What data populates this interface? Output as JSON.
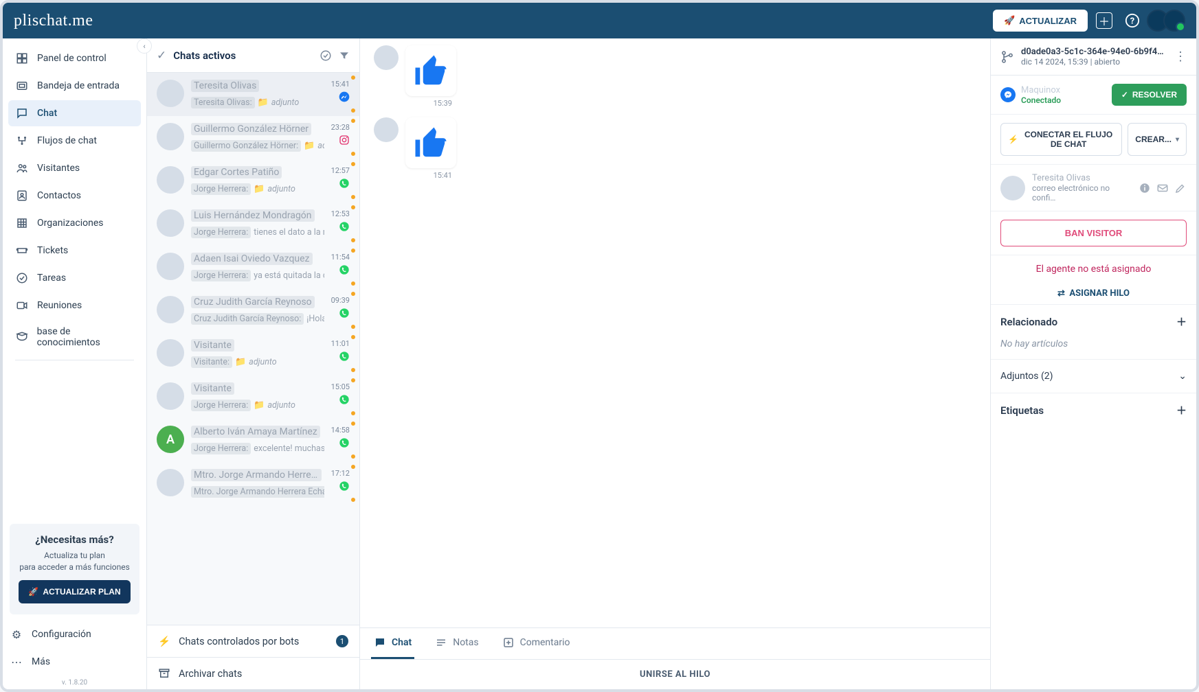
{
  "brand": {
    "name": "plischat.me",
    "tagline": ""
  },
  "topbar": {
    "update_label": "ACTUALIZAR"
  },
  "sidebar": {
    "items": [
      {
        "label": "Panel de control",
        "icon": "dashboard"
      },
      {
        "label": "Bandeja de entrada",
        "icon": "inbox"
      },
      {
        "label": "Chat",
        "icon": "chat",
        "active": true
      },
      {
        "label": "Flujos de chat",
        "icon": "flow"
      },
      {
        "label": "Visitantes",
        "icon": "visitors"
      },
      {
        "label": "Contactos",
        "icon": "contacts"
      },
      {
        "label": "Organizaciones",
        "icon": "org"
      },
      {
        "label": "Tickets",
        "icon": "tickets"
      },
      {
        "label": "Tareas",
        "icon": "tasks"
      },
      {
        "label": "Reuniones",
        "icon": "meetings"
      },
      {
        "label": "base de conocimientos",
        "icon": "kb"
      }
    ],
    "settings_label": "Configuración",
    "more_label": "Más",
    "version": "v. 1.8.20",
    "upgrade": {
      "title": "¿Necesitas más?",
      "line1": "Actualiza tu plan",
      "line2": "para acceder a más funciones",
      "button": "ACTUALIZAR PLAN"
    }
  },
  "chats": {
    "header_title": "Chats activos",
    "bot_section": "Chats controlados por bots",
    "bot_badge": "1",
    "archive_section": "Archivar chats",
    "items": [
      {
        "name": "Teresita Olivas",
        "author": "Teresita Olivas:",
        "preview": "adjunto",
        "is_attachment": true,
        "time": "15:41",
        "channel": "messenger",
        "active": true
      },
      {
        "name": "Guillermo González Hörner",
        "author": "Guillermo González Hörner:",
        "preview": "adju…",
        "is_attachment": true,
        "time": "23:28",
        "channel": "instagram"
      },
      {
        "name": "Edgar Cortes Patiño",
        "author": "Jorge Herrera:",
        "preview": "adjunto",
        "is_attachment": true,
        "time": "12:57",
        "channel": "whatsapp"
      },
      {
        "name": "Luis Hernández Mondragón",
        "author": "Jorge Herrera:",
        "preview": "tienes el dato a la m…",
        "is_attachment": false,
        "time": "12:53",
        "channel": "whatsapp"
      },
      {
        "name": "Adaen Isai Oviedo Vazquez",
        "author": "Jorge Herrera:",
        "preview": "ya está quitada la de …",
        "is_attachment": false,
        "time": "11:54",
        "channel": "whatsapp"
      },
      {
        "name": "Cruz Judith García Reynoso",
        "author": "Cruz Judith García Reynoso:",
        "preview": "¡Hola, …",
        "is_attachment": false,
        "time": "09:39",
        "channel": "whatsapp"
      },
      {
        "name": "Visitante",
        "author": "Visitante:",
        "preview": "adjunto",
        "is_attachment": true,
        "time": "11:01",
        "channel": "whatsapp"
      },
      {
        "name": "Visitante",
        "author": "Jorge Herrera:",
        "preview": "adjunto",
        "is_attachment": true,
        "time": "15:05",
        "channel": "whatsapp"
      },
      {
        "name": "Alberto Iván Amaya Martínez",
        "author": "Jorge Herrera:",
        "preview": "excelente! muchas g…",
        "is_attachment": false,
        "time": "14:58",
        "channel": "whatsapp",
        "avatar_letter": "A",
        "avatar_color": "#4caf50"
      },
      {
        "name": "Mtro. Jorge Armando Herrera E…",
        "author": "Mtro. Jorge Armando Herrera Echau…",
        "preview": "",
        "is_attachment": false,
        "time": "17:12",
        "channel": "whatsapp"
      }
    ]
  },
  "conversation": {
    "messages": [
      {
        "time": "15:39"
      },
      {
        "time": "15:41"
      }
    ],
    "tabs": {
      "chat": "Chat",
      "notes": "Notas",
      "comment": "Comentario"
    },
    "join_label": "UNIRSE AL HILO"
  },
  "detail": {
    "thread_id": "d0ade0a3-5c1c-364e-94e0-6b9f46e…",
    "thread_meta": "dic 14 2024, 15:39 | abierto",
    "channel_name": "Maquinox",
    "channel_status": "Conectado",
    "resolve_label": "RESOLVER",
    "connect_flow": "CONECTAR EL FLUJO DE CHAT",
    "create_label": "CREAR...",
    "contact_name": "Teresita Olivas",
    "contact_sub": "correo electrónico no confi…",
    "ban_label": "BAN VISITOR",
    "no_agent": "El agente no está asignado",
    "assign_label": "ASIGNAR HILO",
    "related_title": "Relacionado",
    "related_empty": "No hay artículos",
    "attachments_title": "Adjuntos (2)",
    "tags_title": "Etiquetas"
  }
}
